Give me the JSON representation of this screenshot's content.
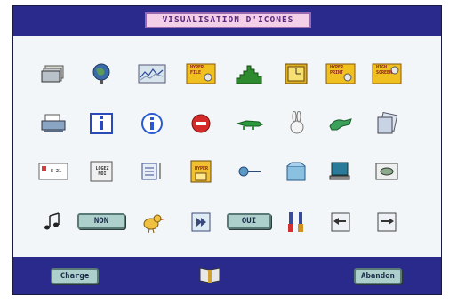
{
  "window": {
    "title": "VISUALISATION D'ICONES"
  },
  "icons": {
    "hyper_file": "HYPER FILE",
    "hyper_print": "HYPER PRINT",
    "high_screen": "HIGH SCREEN",
    "info_letter": "i",
    "loupe_text": "LOGEZ MOI",
    "envelope_text": "E-21",
    "book_badge": "HYPER"
  },
  "buttons": {
    "non": "NON",
    "oui": "OUI",
    "charge": "Charge",
    "abandon": "Abandon"
  },
  "colors": {
    "title_bar": "#2a2a8c",
    "canvas": "#f3f6f8",
    "button_bg": "#aed0cc",
    "title_box_bg": "#f4d0e8"
  }
}
